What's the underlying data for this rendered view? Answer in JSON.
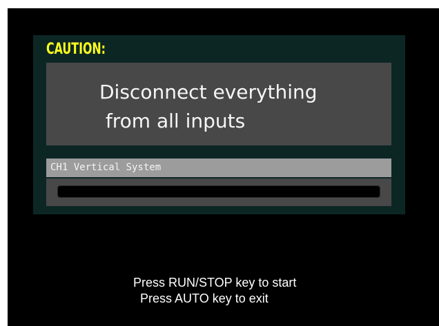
{
  "dialog": {
    "caution_label": "CAUTION:",
    "message_line1": "Disconnect everything",
    "message_line2": " from all inputs",
    "channel_label": "CH1 Vertical System",
    "progress_fraction": 0
  },
  "instructions": {
    "line1": "Press RUN/STOP key to start",
    "line2": "Press AUTO key to exit"
  },
  "colors": {
    "caution": "#ffff1e",
    "dialog_bg": "#0c2624",
    "panel_bg": "#484848",
    "label_bg": "#9c9c9c"
  }
}
